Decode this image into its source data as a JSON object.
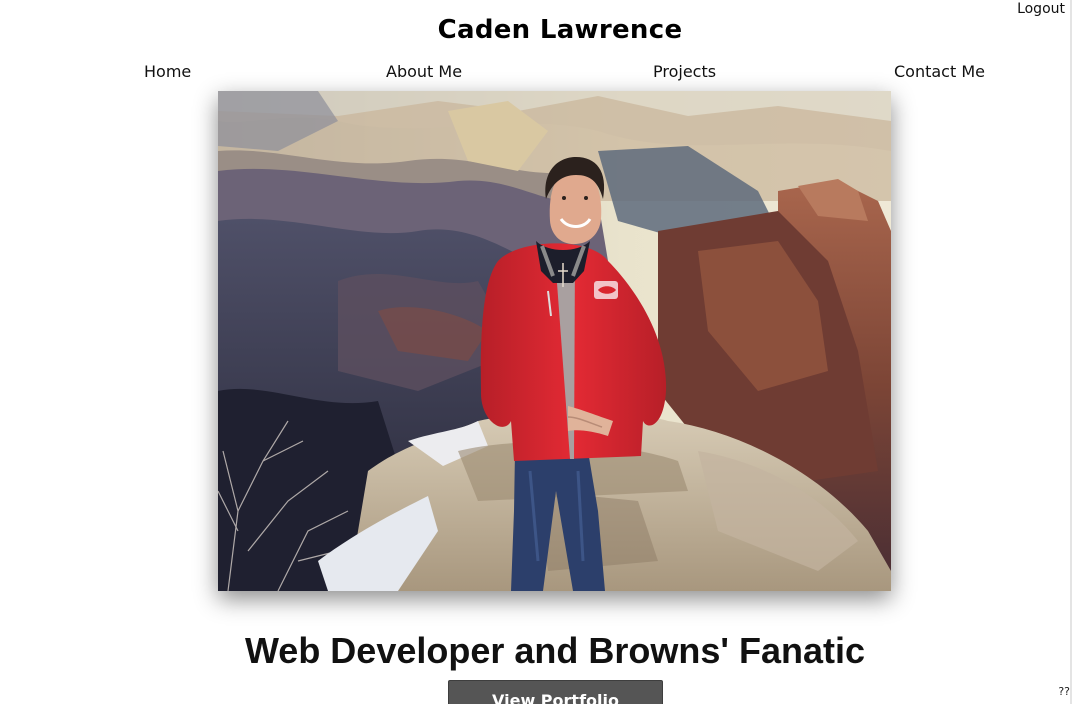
{
  "header": {
    "logout_label": "Logout",
    "site_title": "Caden Lawrence"
  },
  "nav": {
    "items": [
      {
        "label": "Home"
      },
      {
        "label": "About Me"
      },
      {
        "label": "Projects"
      },
      {
        "label": "Contact Me"
      }
    ]
  },
  "hero": {
    "image_alt": "Photo of Caden Lawrence standing on a snowy rock ledge at the Grand Canyon wearing a red Ohio State jacket"
  },
  "main": {
    "tagline": "Web Developer and Browns' Fanatic",
    "cta_label": "View Portfolio"
  },
  "footer": {
    "corner_mark": "??"
  },
  "colors": {
    "cta_background": "#555555",
    "jacket_red": "#d9262e",
    "canyon_rock": "#8a4a3c",
    "sky_haze": "#d8d2c2"
  }
}
